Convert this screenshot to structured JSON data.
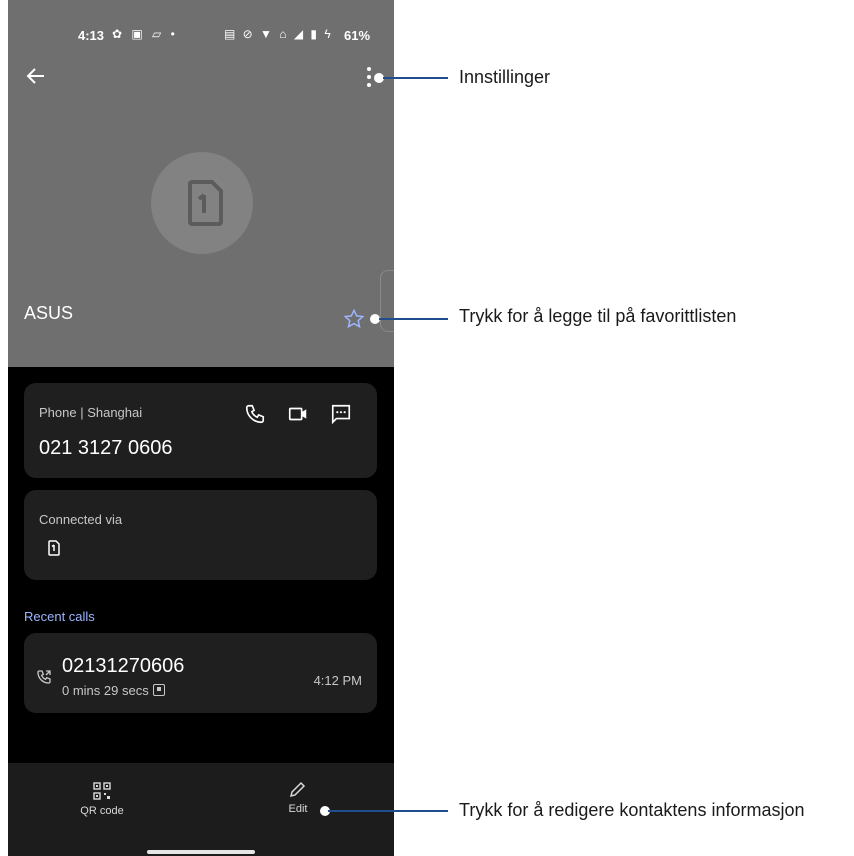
{
  "status_bar": {
    "time": "4:13",
    "left_icons": "✿ ▣ ▱ •",
    "right_icons": "▤ ⊘ ▼ ⌂ ◢ ▮ ϟ",
    "battery": "61%"
  },
  "contact": {
    "name": "ASUS",
    "avatar_icon": "sim-card-1-icon"
  },
  "phone_card": {
    "label": "Phone | Shanghai",
    "number": "021 3127 0606",
    "actions": [
      "call-icon",
      "video-call-icon",
      "message-icon"
    ]
  },
  "connected_card": {
    "label": "Connected via",
    "icon": "sim-card-1-icon"
  },
  "recent_calls": {
    "title": "Recent calls",
    "items": [
      {
        "number": "02131270606",
        "detail": "0 mins 29 secs",
        "time": "4:12 PM"
      }
    ]
  },
  "bottom_bar": {
    "qr_label": "QR code",
    "edit_label": "Edit"
  },
  "callouts": {
    "settings": "Innstillinger",
    "favorite": "Trykk for å legge til på favorittlisten",
    "edit": "Trykk for å redigere kontaktens informasjon"
  },
  "colors": {
    "header_bg": "#6f6f6f",
    "card_bg": "#1f1f1f",
    "accent": "#9db6ff",
    "callout_line": "#1f4e8c"
  }
}
